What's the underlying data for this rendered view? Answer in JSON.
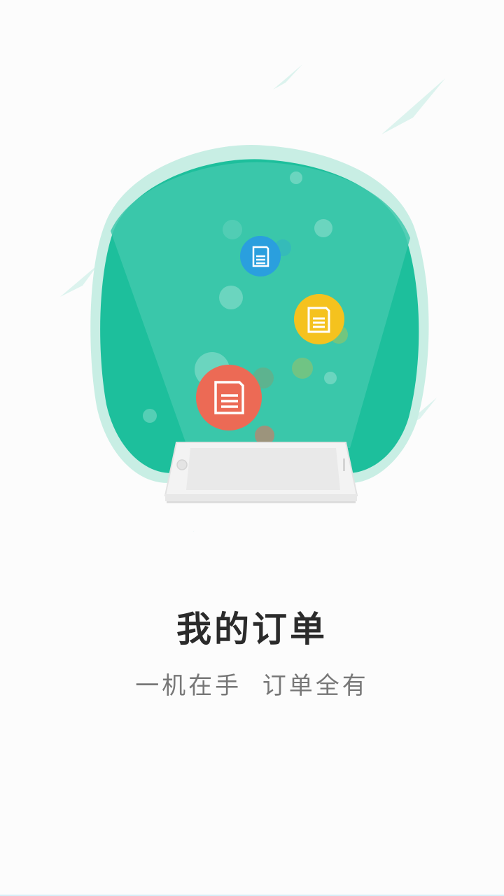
{
  "onboarding": {
    "title": "我的订单",
    "subtitle": "一机在手  订单全有"
  },
  "colors": {
    "blob_teal": "#1dbf9c",
    "blob_light": "#3fc8ad",
    "halo": "#c8eee4",
    "leaf": "#dcf3ee",
    "icon_blue": "#2a9fde",
    "icon_yellow": "#f5c21e",
    "icon_red": "#ec6a55",
    "phone_body": "#f5f5f5",
    "title_text": "#2b2b2b",
    "subtitle_text": "#777777"
  },
  "icons": [
    "document-icon-blue",
    "document-icon-yellow",
    "document-icon-red"
  ]
}
